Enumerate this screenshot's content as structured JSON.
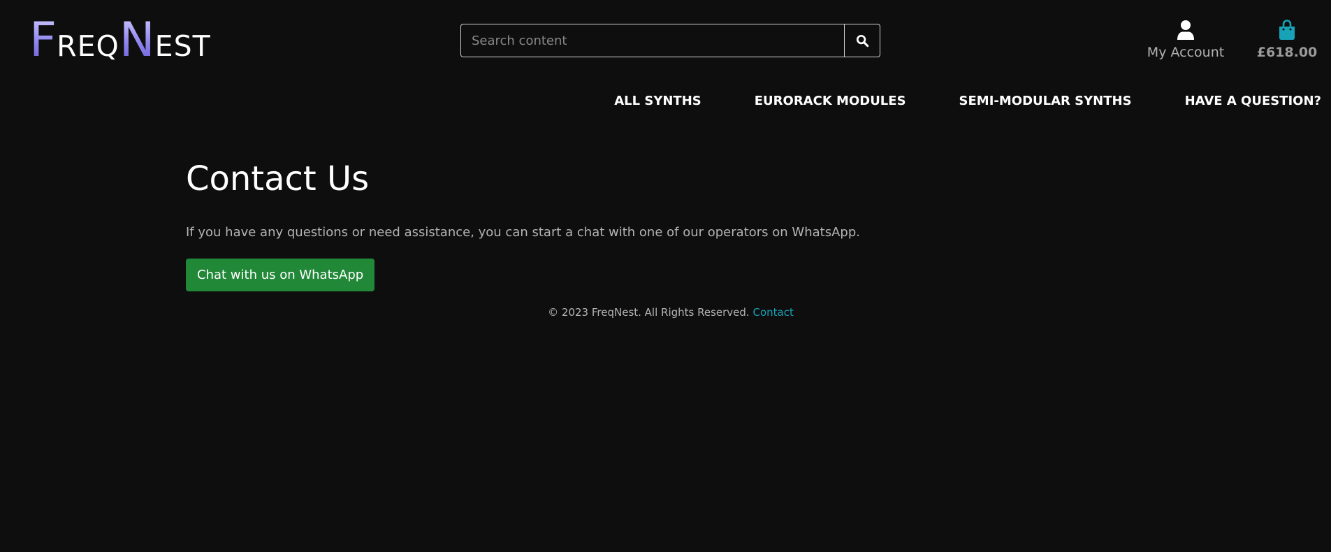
{
  "brand": {
    "logo_parts": [
      {
        "text": "F",
        "style": "cap"
      },
      {
        "text": "REQ",
        "style": "small"
      },
      {
        "text": "N",
        "style": "cap"
      },
      {
        "text": "EST",
        "style": "small"
      }
    ],
    "logo_gradient": [
      "#c9c5ff",
      "#8e84ee",
      "#6a5fd8"
    ]
  },
  "search": {
    "placeholder": "Search content",
    "value": "",
    "button_icon": "search-icon"
  },
  "account": {
    "label": "My Account",
    "icon": "user-icon"
  },
  "bag": {
    "total": "£618.00",
    "icon": "shopping-bag-icon",
    "icon_color": "#17a2b8"
  },
  "nav": {
    "items": [
      {
        "label": "ALL SYNTHS"
      },
      {
        "label": "EURORACK MODULES"
      },
      {
        "label": "SEMI-MODULAR SYNTHS"
      },
      {
        "label": "HAVE A QUESTION?"
      }
    ]
  },
  "main": {
    "title": "Contact Us",
    "text": "If you have any questions or need assistance, you can start a chat with one of our operators on WhatsApp.",
    "button_label": "Chat with us on WhatsApp",
    "button_color": "#218838"
  },
  "footer": {
    "copyright": "© 2023 FreqNest. All Rights Reserved.",
    "link_label": "Contact",
    "link_color": "#17a2b8"
  },
  "colors": {
    "background": "#0e0e0e",
    "text": "#ffffff",
    "muted_text": "#b4b4b4"
  }
}
